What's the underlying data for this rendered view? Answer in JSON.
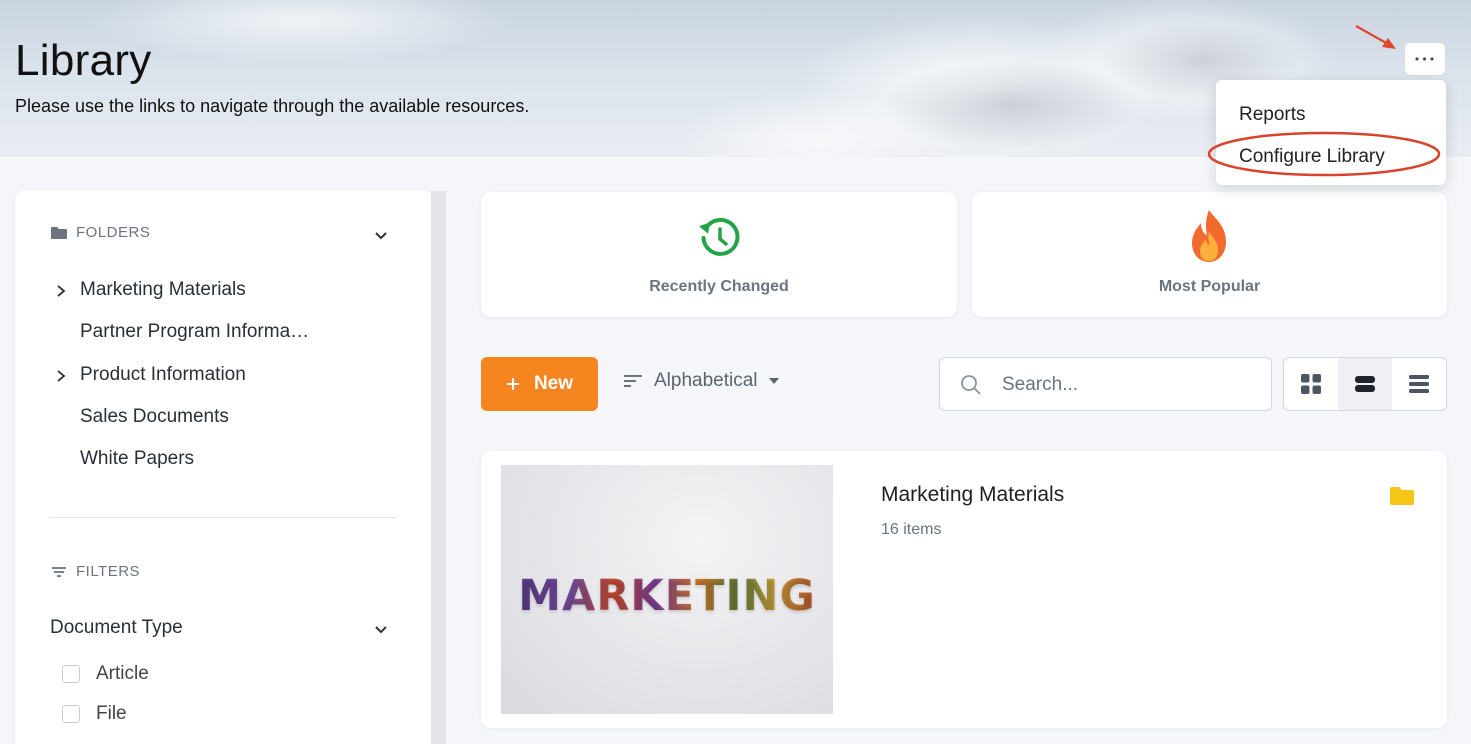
{
  "header": {
    "title": "Library",
    "subtitle": "Please use the links to navigate through the available resources.",
    "more_button_label": "•••"
  },
  "menu": {
    "items": [
      {
        "label": "Reports"
      },
      {
        "label": "Configure Library"
      }
    ]
  },
  "sidebar": {
    "folders_heading": "FOLDERS",
    "folders": [
      {
        "label": "Marketing Materials",
        "expandable": true
      },
      {
        "label": "Partner Program Informa…",
        "expandable": false
      },
      {
        "label": "Product Information",
        "expandable": true
      },
      {
        "label": "Sales Documents",
        "expandable": false
      },
      {
        "label": "White Papers",
        "expandable": false
      }
    ],
    "filters_heading": "FILTERS",
    "document_type": {
      "title": "Document Type",
      "options": [
        {
          "label": "Article",
          "checked": false
        },
        {
          "label": "File",
          "checked": false
        }
      ]
    }
  },
  "quick_cards": [
    {
      "label": "Recently Changed",
      "icon": "clock-history-icon",
      "color": "#22a447"
    },
    {
      "label": "Most Popular",
      "icon": "flame-icon",
      "color": "#f26a2e"
    }
  ],
  "toolbar": {
    "new_label": "New",
    "sort_label": "Alphabetical",
    "search_placeholder": "Search...",
    "view_modes": [
      "grid-view",
      "card-view",
      "list-view"
    ],
    "active_view": "card-view",
    "accent_color": "#f5851f"
  },
  "items": [
    {
      "title": "Marketing Materials",
      "count": "16 items",
      "thumbnail_text": "MARKETING",
      "type_icon": "folder-icon",
      "icon_color": "#f5c518"
    }
  ]
}
